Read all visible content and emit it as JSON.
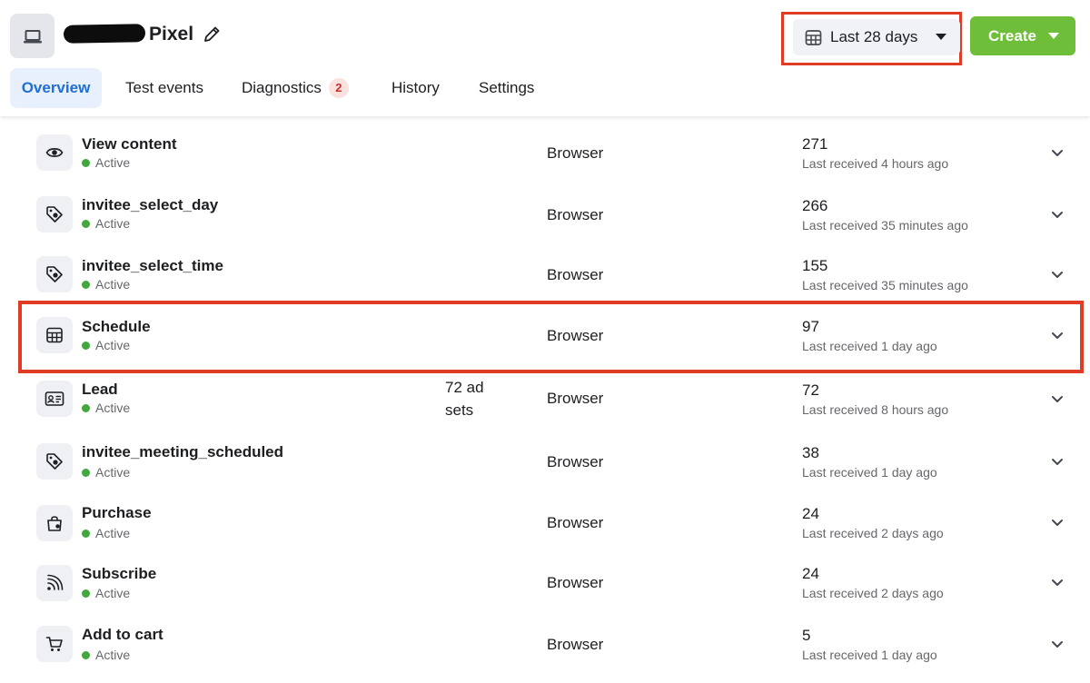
{
  "header": {
    "pixel_name": "Pixel",
    "date_range": "Last 28 days",
    "create_label": "Create"
  },
  "tabs": [
    {
      "label": "Overview",
      "active": true
    },
    {
      "label": "Test events"
    },
    {
      "label": "Diagnostics",
      "badge": "2"
    },
    {
      "label": "History"
    },
    {
      "label": "Settings"
    }
  ],
  "events": [
    {
      "name": "View content",
      "status": "Active",
      "icon": "eye-icon",
      "source": "Browser",
      "count": "271",
      "last": "Last received 4 hours ago"
    },
    {
      "name": "invitee_select_day",
      "status": "Active",
      "icon": "tag-icon",
      "source": "Browser",
      "count": "266",
      "last": "Last received 35 minutes ago"
    },
    {
      "name": "invitee_select_time",
      "status": "Active",
      "icon": "tag-icon",
      "source": "Browser",
      "count": "155",
      "last": "Last received 35 minutes ago"
    },
    {
      "name": "Schedule",
      "status": "Active",
      "icon": "calendar-grid-icon",
      "source": "Browser",
      "count": "97",
      "last": "Last received 1 day ago",
      "highlighted": true
    },
    {
      "name": "Lead",
      "status": "Active",
      "icon": "id-card-icon",
      "ad_sets": [
        "72 ad",
        "sets"
      ],
      "source": "Browser",
      "count": "72",
      "last": "Last received 8 hours ago"
    },
    {
      "name": "invitee_meeting_scheduled",
      "status": "Active",
      "icon": "tag-icon",
      "source": "Browser",
      "count": "38",
      "last": "Last received 1 day ago"
    },
    {
      "name": "Purchase",
      "status": "Active",
      "icon": "shopping-bag-icon",
      "source": "Browser",
      "count": "24",
      "last": "Last received 2 days ago"
    },
    {
      "name": "Subscribe",
      "status": "Active",
      "icon": "rss-feed-icon",
      "source": "Browser",
      "count": "24",
      "last": "Last received 2 days ago"
    },
    {
      "name": "Add to cart",
      "status": "Active",
      "icon": "cart-icon",
      "source": "Browser",
      "count": "5",
      "last": "Last received 1 day ago"
    }
  ],
  "colors": {
    "accent_blue": "#1f6fd6",
    "create_green": "#6ebe3a",
    "active_dot": "#42a73e",
    "annotation_red": "#e03b24",
    "badge_red": "#c9302c"
  }
}
